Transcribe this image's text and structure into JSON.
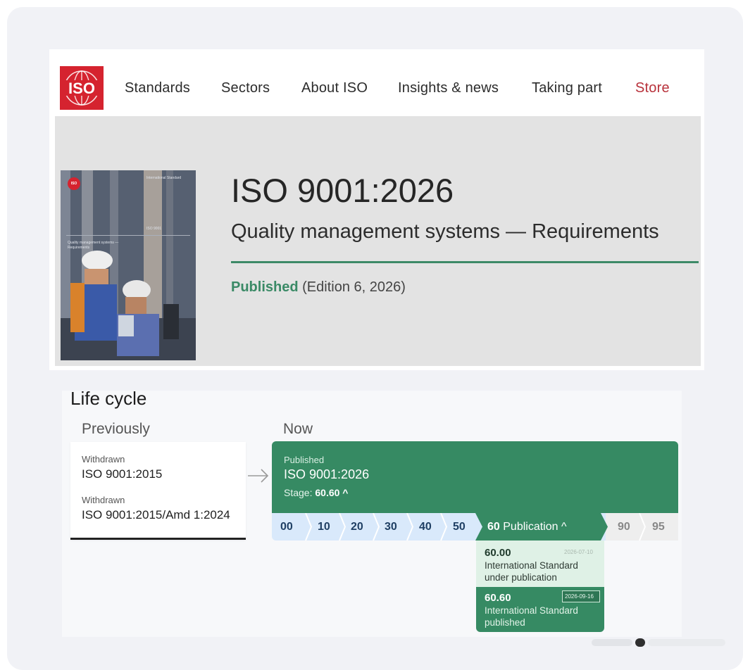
{
  "nav": {
    "logo_text": "ISO",
    "items": [
      "Standards",
      "Sectors",
      "About ISO",
      "Insights & news",
      "Taking part",
      "Store"
    ],
    "accent_color": "#b8323b"
  },
  "standard": {
    "number": "ISO 9001:2026",
    "title": "Quality management systems — Requirements",
    "status": "Published",
    "edition": "(Edition 6, 2026)",
    "cover": {
      "logo_text": "ISO",
      "kind": "International Standard",
      "number": "ISO 9001",
      "title": "Quality management systems — Requirements"
    },
    "accent_color": "#3a8a66"
  },
  "lifecycle": {
    "title": "Life cycle",
    "previously_label": "Previously",
    "now_label": "Now",
    "previous": [
      {
        "status": "Withdrawn",
        "number": "ISO 9001:2015"
      },
      {
        "status": "Withdrawn",
        "number": "ISO 9001:2015/Amd 1:2024"
      }
    ],
    "current": {
      "status": "Published",
      "number": "ISO 9001:2026",
      "stage_label": "Stage:",
      "stage_value": "60.60 ^"
    },
    "stages": [
      "00",
      "10",
      "20",
      "30",
      "40",
      "50"
    ],
    "active_stage": {
      "code": "60",
      "name": "Publication ^"
    },
    "later_stages": [
      "90",
      "95"
    ],
    "substages": [
      {
        "code": "60.00",
        "date": "2026-07-10",
        "description": "International Standard under publication"
      },
      {
        "code": "60.60",
        "date": "2026-09-16",
        "description": "International Standard published"
      }
    ]
  }
}
